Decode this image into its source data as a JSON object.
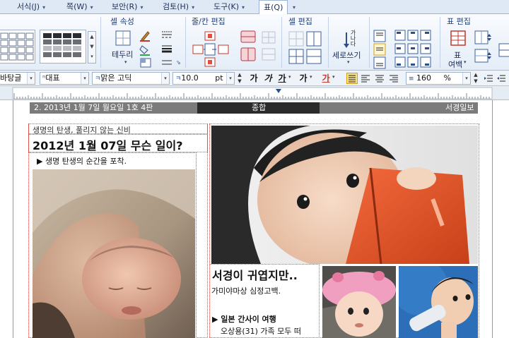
{
  "menu": {
    "tabs": [
      "서식(J)",
      "쪽(W)",
      "보안(R)",
      "검토(H)",
      "도구(K)",
      "표(Q)"
    ]
  },
  "ribbon": {
    "groups": {
      "cell_props": "셀 속성",
      "line_edit": "줄/칸 편집",
      "cell_edit": "셀 편집",
      "table_edit": "표 편집"
    },
    "border_label": "테두리",
    "vertical_label": "세로쓰기",
    "vertical_icon_text": "가나다",
    "table_label_1": "표",
    "table_label_2": "여백"
  },
  "format": {
    "style": "바탕글",
    "lang": "대표",
    "font": "맑은 고딕",
    "size": "10.0",
    "size_unit": "pt",
    "b1": "가",
    "b2": "가",
    "b3": "가",
    "b4": "가",
    "b5": "가",
    "zoom": "160",
    "zoom_unit": "%"
  },
  "document": {
    "header": {
      "left": "2. 2013년 1월 7일 월요일 1호 4판",
      "center": "종합",
      "right": "서경일보"
    },
    "left": {
      "kicker": "생명의 탄생, 풀리지 않는 신비",
      "headline": "2012년 1월 07일 무슨 일이?",
      "subhead": "▶ 생명 탄생의 순간을 포착."
    },
    "right": {
      "headline": "서경이 귀엽지만..",
      "byline": "가미야마상 심정고백.",
      "subhead": "▶ 일본 간사이 여행",
      "body": "오상용(31) 가족 모두 떠"
    }
  },
  "colors": {
    "accent": "#1f4e9c",
    "dotted_frame": "#e05050",
    "menubar": "#dfe9f6"
  }
}
